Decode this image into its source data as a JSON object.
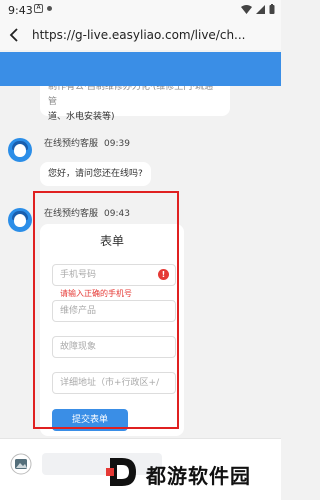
{
  "status_bar": {
    "time": "9:43",
    "notification_icon": "A"
  },
  "address_bar": {
    "url": "https://g-live.easyliao.com/live/ch..."
  },
  "chat": {
    "previous_bubble_line1": "制作有公·自制维修办力化·(维修上门·疏通管",
    "previous_bubble_line2": "道、水电安装等)",
    "messages": [
      {
        "sender": "在线预约客服",
        "time": "09:39",
        "text": "您好，请问您还在线吗?"
      },
      {
        "sender": "在线预约客服",
        "time": "09:43"
      }
    ]
  },
  "form": {
    "title": "表单",
    "phone_placeholder": "手机号码",
    "phone_error": "请输入正确的手机号",
    "error_icon": "!",
    "product_placeholder": "维修产品",
    "issue_placeholder": "故障现象",
    "address_placeholder": "详细地址（市+行政区+/",
    "submit_label": "提交表单"
  },
  "watermark": {
    "text": "都游软件园"
  },
  "colors": {
    "accent": "#3a8ee6",
    "error": "#e53935",
    "highlight": "#e02020"
  }
}
